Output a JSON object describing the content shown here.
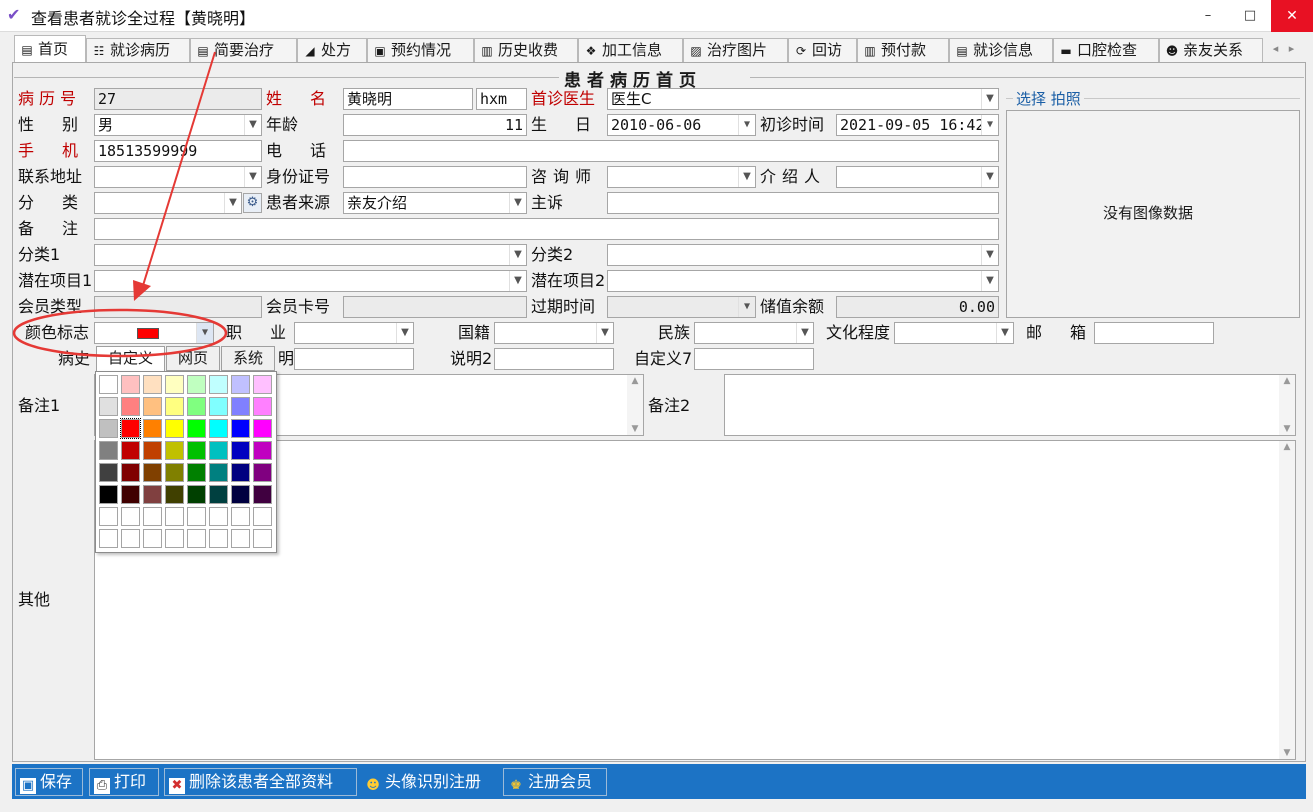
{
  "window": {
    "title": "查看患者就诊全过程【黄晓明】",
    "minimize": "–",
    "maximize": "□",
    "close": "✕"
  },
  "tabs": [
    {
      "label": "首页",
      "icon": "home-icon",
      "glyph": "▤"
    },
    {
      "label": "就诊病历",
      "icon": "record-icon",
      "glyph": "☷"
    },
    {
      "label": "简要治疗",
      "icon": "document-icon",
      "glyph": "▤"
    },
    {
      "label": "处方",
      "icon": "pill-icon",
      "glyph": "◢"
    },
    {
      "label": "预约情况",
      "icon": "calendar-icon",
      "glyph": "▣"
    },
    {
      "label": "历史收费",
      "icon": "money-icon",
      "glyph": "▥"
    },
    {
      "label": "加工信息",
      "icon": "cubes-icon",
      "glyph": "❖"
    },
    {
      "label": "治疗图片",
      "icon": "picture-icon",
      "glyph": "▨"
    },
    {
      "label": "回访",
      "icon": "refresh-icon",
      "glyph": "⟳"
    },
    {
      "label": "预付款",
      "icon": "wallet-icon",
      "glyph": "▥"
    },
    {
      "label": "就诊信息",
      "icon": "clipboard-icon",
      "glyph": "▤"
    },
    {
      "label": "口腔检查",
      "icon": "briefcase-icon",
      "glyph": "▬"
    },
    {
      "label": "亲友关系",
      "icon": "people-icon",
      "glyph": "☻"
    }
  ],
  "tab_scroll": {
    "left": "◂",
    "right": "▸"
  },
  "page_title": "患者病历首页",
  "form": {
    "record_no": {
      "label": "病历号",
      "value": "27"
    },
    "name": {
      "label": "姓名",
      "value": "黄晓明",
      "pinyin": "hxm"
    },
    "first_doctor": {
      "label": "首诊医生",
      "value": "医生C"
    },
    "gender": {
      "label": "性别",
      "value": "男"
    },
    "age": {
      "label": "年龄",
      "value": "11"
    },
    "birthday": {
      "label": "生日",
      "value": "2010-06-06"
    },
    "first_visit": {
      "label": "初诊时间",
      "value": "2021-09-05 16:42"
    },
    "mobile": {
      "label": "手机",
      "value": "18513599999"
    },
    "phone": {
      "label": "电话",
      "value": ""
    },
    "address": {
      "label": "联系地址",
      "value": ""
    },
    "id_card": {
      "label": "身份证号",
      "value": ""
    },
    "consultant": {
      "label": "咨询师",
      "value": ""
    },
    "referrer": {
      "label": "介绍人",
      "value": ""
    },
    "category": {
      "label": "分类",
      "value": ""
    },
    "source": {
      "label": "患者来源",
      "value": "亲友介绍"
    },
    "chief_complaint": {
      "label": "主诉",
      "value": ""
    },
    "remark": {
      "label": "备注",
      "value": ""
    },
    "category1": {
      "label": "分类1",
      "value": ""
    },
    "category2": {
      "label": "分类2",
      "value": ""
    },
    "potential1": {
      "label": "潜在项目1",
      "value": ""
    },
    "potential2": {
      "label": "潜在项目2",
      "value": ""
    },
    "member_type": {
      "label": "会员类型",
      "value": ""
    },
    "member_card": {
      "label": "会员卡号",
      "value": ""
    },
    "expire": {
      "label": "过期时间",
      "value": ""
    },
    "balance": {
      "label": "储值余额",
      "value": "0.00"
    },
    "color_tag": {
      "label": "颜色标志",
      "color": "#ff0000"
    },
    "occupation": {
      "label": "职业",
      "value": ""
    },
    "nationality": {
      "label": "国籍",
      "value": ""
    },
    "ethnicity": {
      "label": "民族",
      "value": ""
    },
    "education": {
      "label": "文化程度",
      "value": ""
    },
    "email": {
      "label": "邮箱",
      "value": ""
    },
    "history": {
      "label": "病史",
      "value": ""
    },
    "note1_partial": {
      "label": "明1",
      "value": ""
    },
    "note2": {
      "label": "说明2",
      "value": ""
    },
    "custom7": {
      "label": "自定义7",
      "value": ""
    },
    "remark1": {
      "label": "备注1"
    },
    "remark2": {
      "label": "备注2"
    },
    "other": {
      "label": "其他"
    }
  },
  "photo": {
    "links": "选择  拍照",
    "empty": "没有图像数据"
  },
  "color_picker": {
    "tabs": [
      "自定义",
      "网页",
      "系统"
    ],
    "active_tab": 0,
    "selected": "#ff0000",
    "rows": [
      [
        "#ffffff",
        "#ffc0c0",
        "#ffe0c0",
        "#ffffc0",
        "#c0ffc0",
        "#c0ffff",
        "#c0c0ff",
        "#ffc0ff"
      ],
      [
        "#e0e0e0",
        "#ff8080",
        "#ffc080",
        "#ffff80",
        "#80ff80",
        "#80ffff",
        "#8080ff",
        "#ff80ff"
      ],
      [
        "#c0c0c0",
        "#ff0000",
        "#ff8000",
        "#ffff00",
        "#00ff00",
        "#00ffff",
        "#0000ff",
        "#ff00ff"
      ],
      [
        "#808080",
        "#c00000",
        "#c04000",
        "#c0c000",
        "#00c000",
        "#00c0c0",
        "#0000c0",
        "#c000c0"
      ],
      [
        "#404040",
        "#800000",
        "#804000",
        "#808000",
        "#008000",
        "#008080",
        "#000080",
        "#800080"
      ],
      [
        "#000000",
        "#400000",
        "#804040",
        "#404000",
        "#004000",
        "#004040",
        "#000040",
        "#400040"
      ],
      [
        "#ffffff",
        "#ffffff",
        "#ffffff",
        "#ffffff",
        "#ffffff",
        "#ffffff",
        "#ffffff",
        "#ffffff"
      ],
      [
        "#ffffff",
        "#ffffff",
        "#ffffff",
        "#ffffff",
        "#ffffff",
        "#ffffff",
        "#ffffff",
        "#ffffff"
      ]
    ]
  },
  "toolbar": {
    "save": "保存",
    "print": "打印",
    "delete_all": "删除该患者全部资料",
    "face_register": "头像识别注册",
    "register_member": "注册会员"
  },
  "colors": {
    "accent": "#1c73c5",
    "annotation": "#e53935",
    "required_label": "#c00000"
  }
}
